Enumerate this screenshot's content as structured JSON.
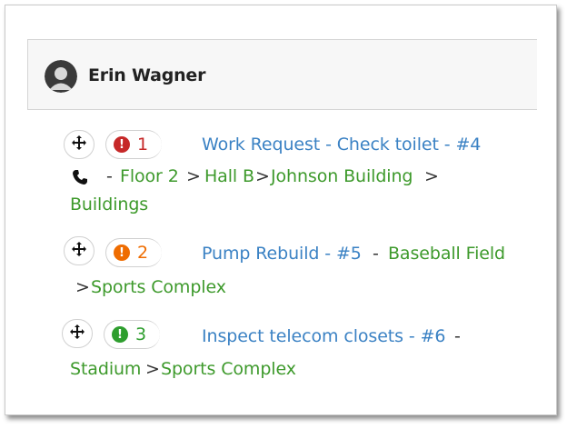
{
  "header": {
    "name": "Erin Wagner"
  },
  "items": [
    {
      "priority": "1",
      "priority_color": "#c62828",
      "title": "Work Request - Check toilet - #4",
      "dash": "-",
      "location": [
        "Floor 2",
        "Hall B",
        "Johnson Building",
        "Buildings"
      ],
      "separator": ">"
    },
    {
      "priority": "2",
      "priority_color": "#ef6c00",
      "title": "Pump Rebuild - #5",
      "dash": "-",
      "location": [
        "Baseball Field",
        "Sports Complex"
      ],
      "separator": ">"
    },
    {
      "priority": "3",
      "priority_color": "#2e9e2e",
      "title": "Inspect telecom closets - #6",
      "dash": "-",
      "location": [
        "Stadium",
        "Sports Complex"
      ],
      "separator": ">"
    }
  ]
}
